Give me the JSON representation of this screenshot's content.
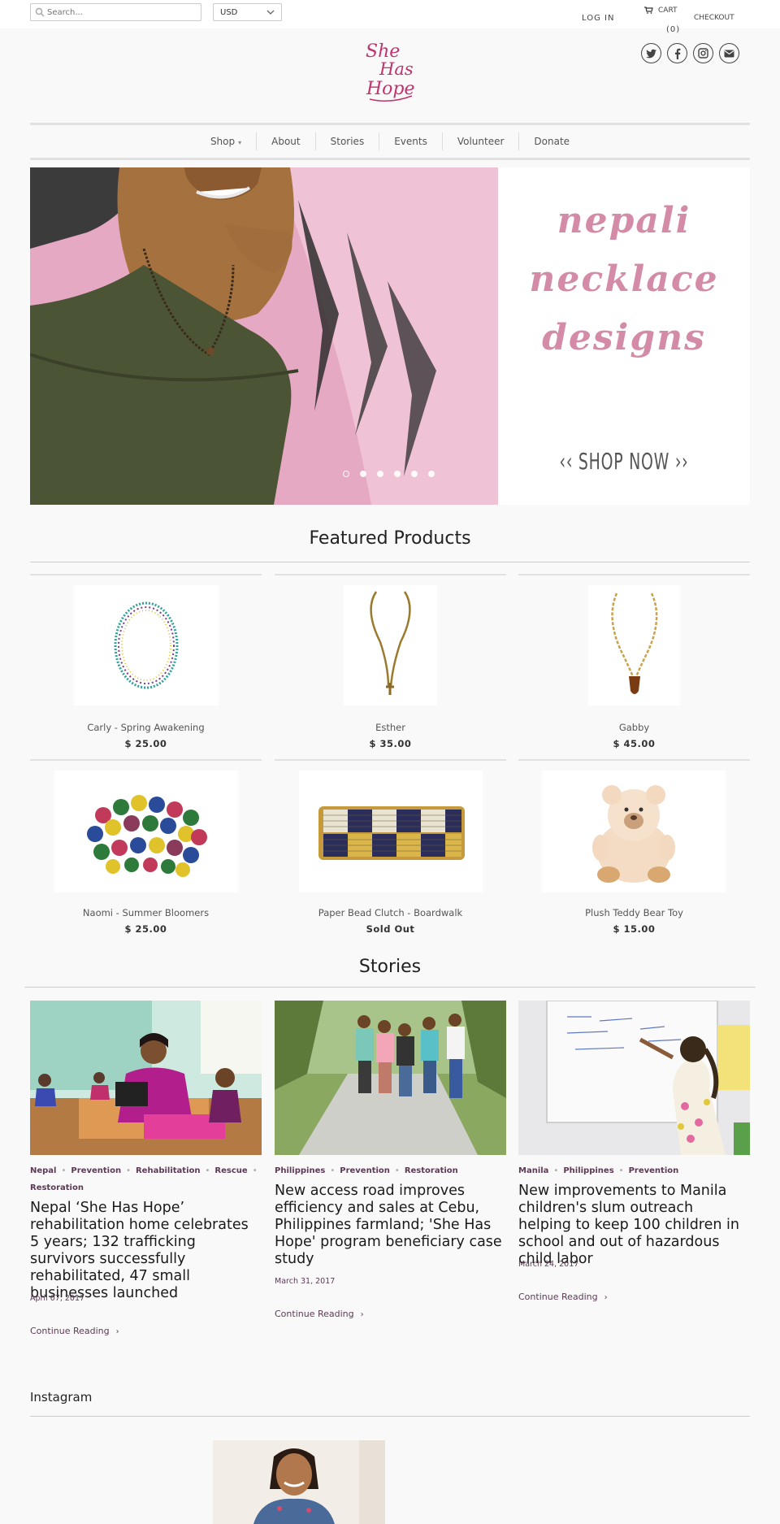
{
  "topbar": {
    "search_placeholder": "Search...",
    "currency": "USD",
    "login": "LOG IN",
    "cart": "CART",
    "cart_count": "(0)",
    "checkout": "CHECKOUT"
  },
  "social": [
    "twitter-icon",
    "facebook-icon",
    "instagram-icon",
    "email-icon"
  ],
  "logo": {
    "line1": "She",
    "line2": "Has",
    "line3": "Hope",
    "color": "#c2336d"
  },
  "nav": {
    "items": [
      "Shop",
      "About",
      "Stories",
      "Events",
      "Volunteer",
      "Donate"
    ]
  },
  "hero": {
    "line1": "nepali",
    "line2": "necklace",
    "line3": "designs",
    "cta": "‹‹ SHOP NOW ››",
    "slide_count": 6,
    "active_slide": 1
  },
  "featured": {
    "title": "Featured Products",
    "products": [
      {
        "name": "Carly - Spring Awakening",
        "price": "$ 25.00"
      },
      {
        "name": "Esther",
        "price": "$ 35.00"
      },
      {
        "name": "Gabby",
        "price": "$ 45.00"
      },
      {
        "name": "Naomi - Summer Bloomers",
        "price": "$ 25.00"
      },
      {
        "name": "Paper Bead Clutch - Boardwalk",
        "price": "Sold Out"
      },
      {
        "name": "Plush Teddy Bear Toy",
        "price": "$ 15.00"
      }
    ]
  },
  "stories": {
    "title": "Stories",
    "items": [
      {
        "tags": [
          "Nepal",
          "Prevention",
          "Rehabilitation",
          "Rescue",
          "Restoration"
        ],
        "title": "Nepal ‘She Has Hope’ rehabilitation home celebrates 5 years; 132 trafficking survivors successfully rehabilitated, 47 small businesses launched",
        "date": "April 07, 2017",
        "more": "Continue Reading"
      },
      {
        "tags": [
          "Philippines",
          "Prevention",
          "Restoration"
        ],
        "title": "New access road improves efficiency and sales at Cebu, Philippines farmland; 'She Has Hope' program beneficiary case study",
        "date": "March 31, 2017",
        "more": "Continue Reading"
      },
      {
        "tags": [
          "Manila",
          "Philippines",
          "Prevention"
        ],
        "title": "New improvements to Manila children's slum outreach helping to keep 100 children in school and out of hazardous child labor",
        "date": "March 24, 2017",
        "more": "Continue Reading"
      }
    ]
  },
  "instagram": {
    "title": "Instagram"
  },
  "colors": {
    "accent": "#5c3a55",
    "logo": "#c2336d",
    "hero_text": "#d48ba8"
  }
}
